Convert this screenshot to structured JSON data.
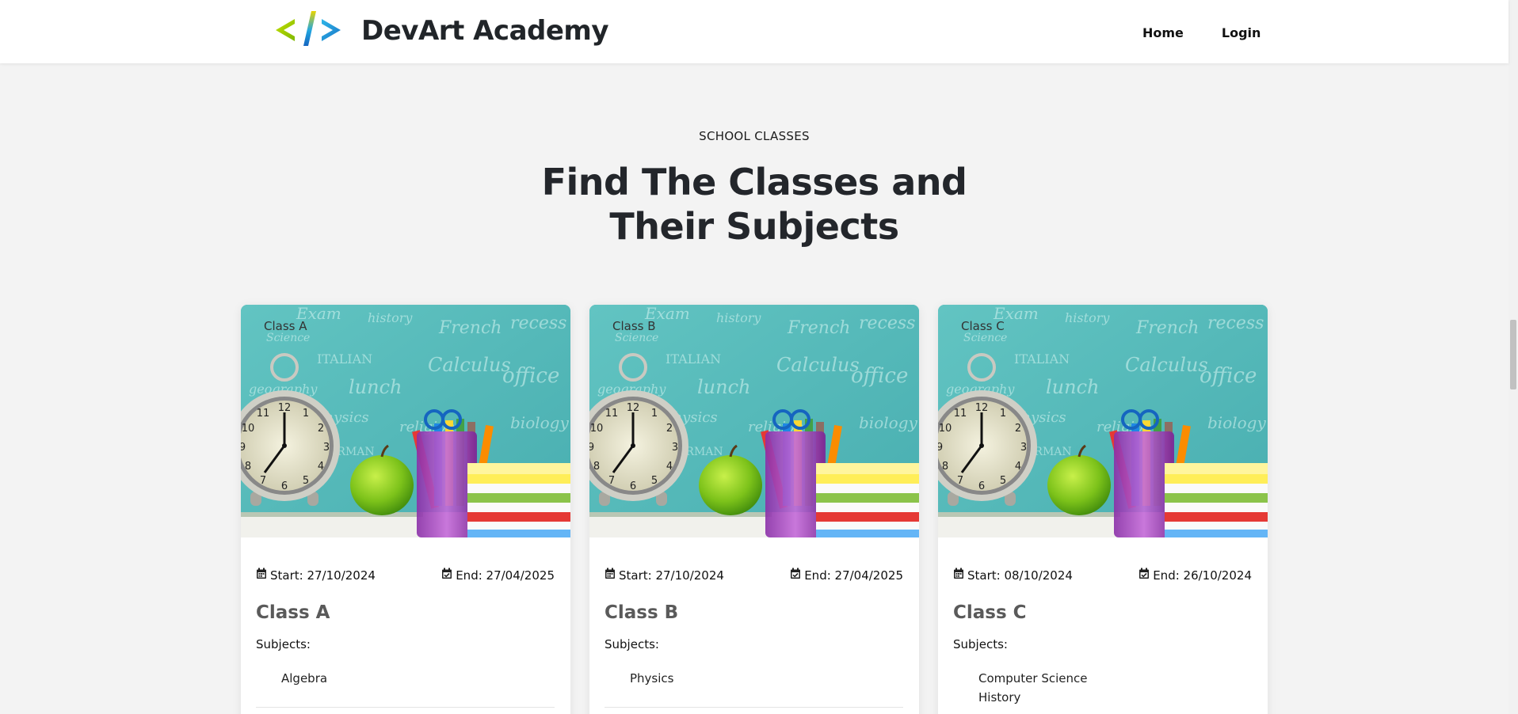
{
  "header": {
    "brand_name": "DevArt Academy",
    "logo_icon": "code-brackets-logo",
    "nav": [
      {
        "label": "Home"
      },
      {
        "label": "Login"
      }
    ]
  },
  "section": {
    "eyebrow": "SCHOOL CLASSES",
    "headline_line1": "Find The Classes and",
    "headline_line2": "Their Subjects"
  },
  "cards": [
    {
      "image_label": "Class A",
      "start": "Start: 27/10/2024",
      "end": "End: 27/04/2025",
      "title": "Class A",
      "subjects_label": "Subjects:",
      "subjects": [
        "Algebra"
      ]
    },
    {
      "image_label": "Class B",
      "start": "Start: 27/10/2024",
      "end": "End: 27/04/2025",
      "title": "Class B",
      "subjects_label": "Subjects:",
      "subjects": [
        "Physics"
      ]
    },
    {
      "image_label": "Class C",
      "start": "Start: 08/10/2024",
      "end": "End: 26/10/2024",
      "title": "Class C",
      "subjects_label": "Subjects:",
      "subjects": [
        "Computer Science",
        "History"
      ]
    }
  ],
  "colors": {
    "background": "#f3f3f3",
    "card": "#ffffff",
    "heading": "#23262b",
    "class_title": "#5a5a5a",
    "chalkboard": "#5bbfbc"
  },
  "icons": {
    "start_date": "calendar-icon",
    "end_date": "calendar-check-icon"
  }
}
